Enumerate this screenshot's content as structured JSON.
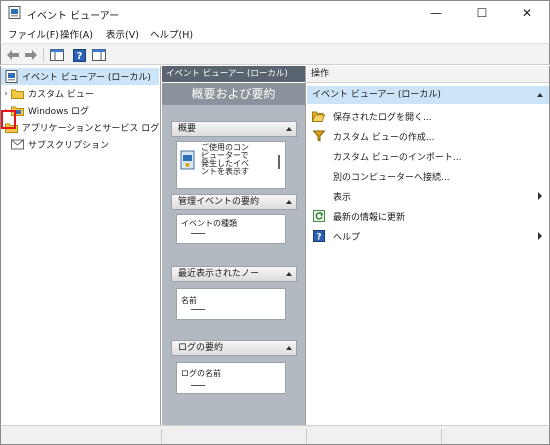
{
  "window": {
    "title": "イベント ビューアー",
    "minimize": "—",
    "maximize": "☐",
    "close": "✕"
  },
  "menu": [
    "ファイル(F)",
    "操作(A)",
    "表示(V)",
    "ヘルプ(H)"
  ],
  "tree": {
    "root": "イベント ビューアー (ローカル)",
    "items": [
      "カスタム ビュー",
      "Windows ログ",
      "アプリケーションとサービス ログ",
      "サブスクリプション"
    ]
  },
  "center": {
    "header": "イベント ビューアー (ローカル)",
    "title": "概要および要約",
    "overview": {
      "header": "概要",
      "text_lines": [
        "ご使用のコン",
        "ピューターで",
        "発生したイベ",
        "ントを表示す"
      ]
    },
    "summary": {
      "header": "管理イベントの要約",
      "column": "イベントの種類"
    },
    "recent": {
      "header": "最近表示されたノー",
      "column": "名前"
    },
    "logs": {
      "header": "ログの要約",
      "column": "ログの名前"
    }
  },
  "actions": {
    "header": "操作",
    "section": "イベント ビューアー (ローカル)",
    "items": [
      {
        "label": "保存されたログを開く...",
        "icon": "folder-icon"
      },
      {
        "label": "カスタム ビューの作成...",
        "icon": "filter-icon"
      },
      {
        "label": "カスタム ビューのインポート...",
        "icon": ""
      },
      {
        "label": "別のコンピューターへ接続...",
        "icon": ""
      },
      {
        "label": "表示",
        "icon": "",
        "submenu": true
      },
      {
        "label": "最新の情報に更新",
        "icon": "refresh-icon"
      },
      {
        "label": "ヘルプ",
        "icon": "help-icon",
        "submenu": true
      }
    ]
  },
  "colors": {
    "selection": "#cce4f7",
    "highlight_box": "#e8121a",
    "center_header": "#5a6470",
    "center_body": "#b2b9c1"
  }
}
